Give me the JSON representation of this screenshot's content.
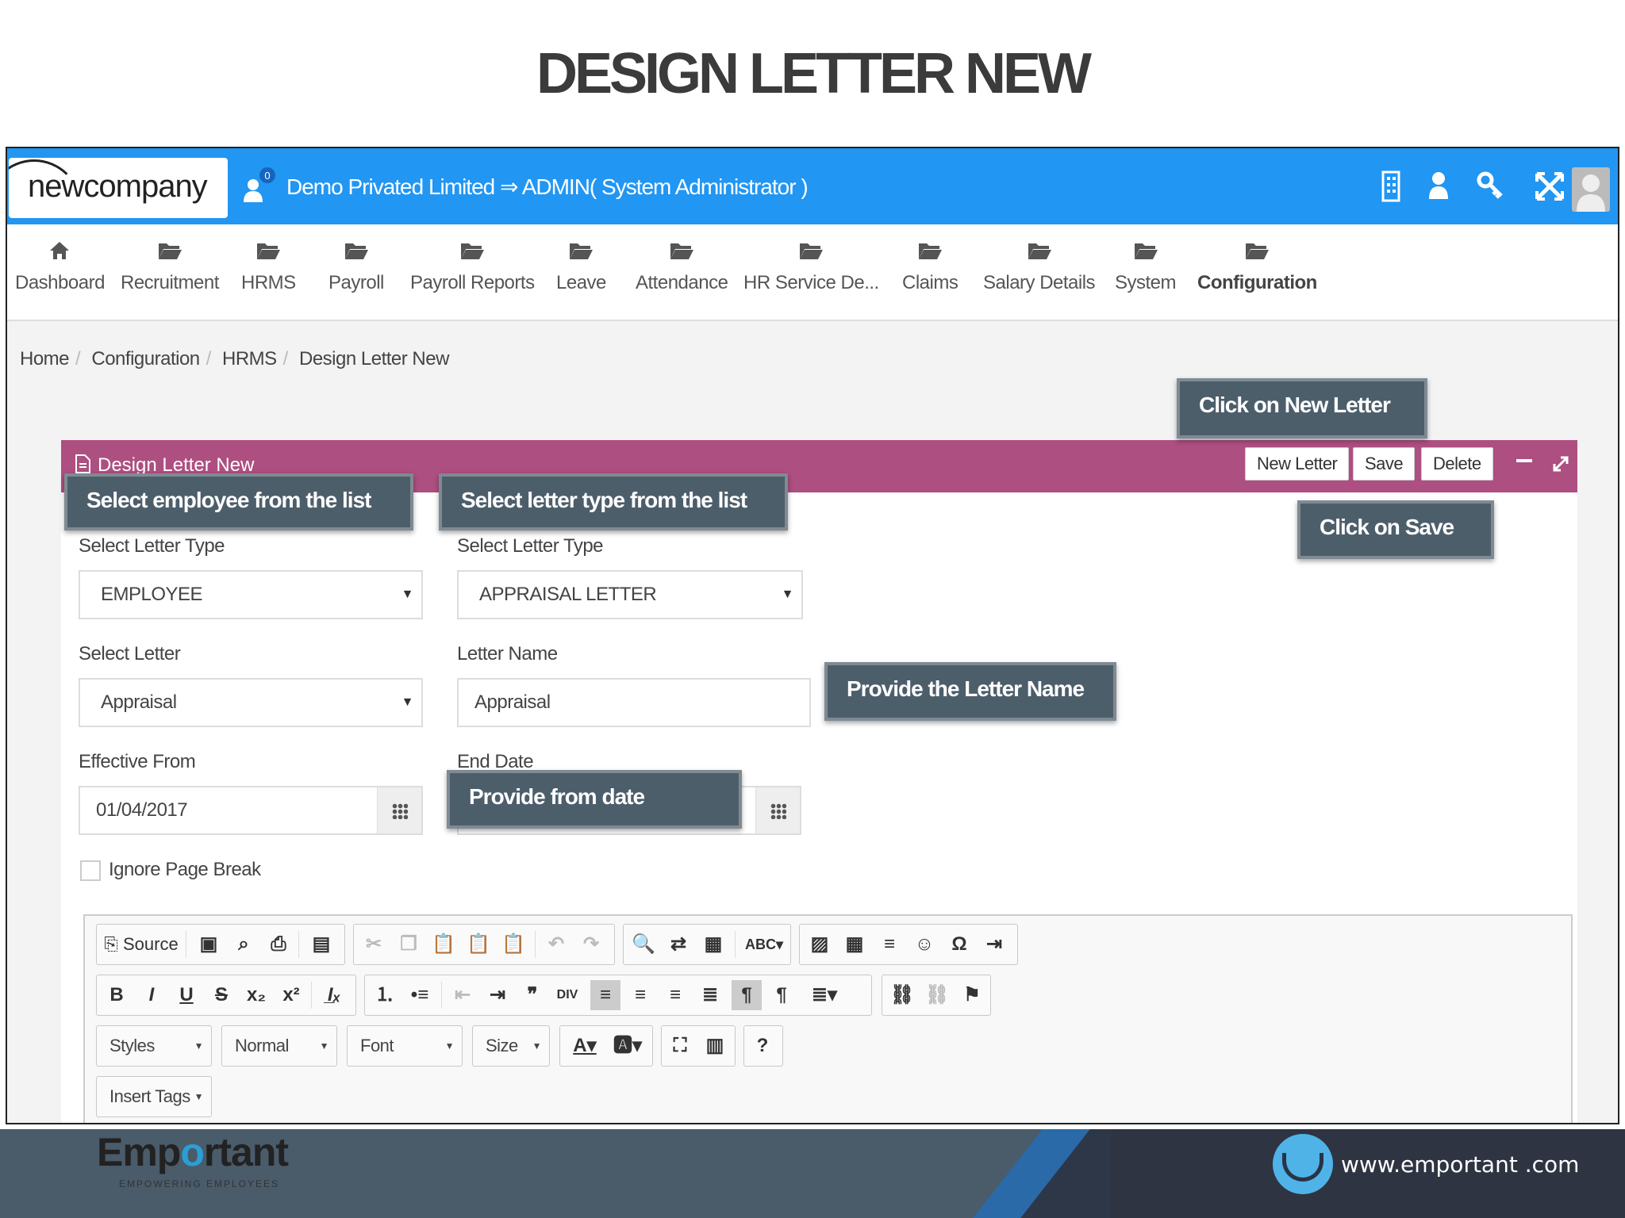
{
  "slide": {
    "title": "DESIGN LETTER NEW"
  },
  "app": {
    "logo_text": "newcompany",
    "notification_count": "0",
    "company_title": "Demo Privated Limited ⇒ ADMIN( System Administrator )",
    "top_icons": [
      "building-icon",
      "user-icon",
      "key-icon",
      "fullscreen-icon",
      "avatar"
    ]
  },
  "menu": [
    {
      "label": "Dashboard",
      "icon": "home-icon"
    },
    {
      "label": "Recruitment",
      "icon": "folder-icon"
    },
    {
      "label": "HRMS",
      "icon": "folder-icon"
    },
    {
      "label": "Payroll",
      "icon": "folder-icon"
    },
    {
      "label": "Payroll Reports",
      "icon": "folder-icon"
    },
    {
      "label": "Leave",
      "icon": "folder-icon"
    },
    {
      "label": "Attendance",
      "icon": "folder-icon"
    },
    {
      "label": "HR Service De...",
      "icon": "folder-icon"
    },
    {
      "label": "Claims",
      "icon": "folder-icon"
    },
    {
      "label": "Salary Details",
      "icon": "folder-icon"
    },
    {
      "label": "System",
      "icon": "folder-icon"
    },
    {
      "label": "Configuration",
      "icon": "folder-icon"
    }
  ],
  "breadcrumb": [
    "Home",
    "Configuration",
    "HRMS",
    "Design Letter New"
  ],
  "panel": {
    "title": "Design Letter New",
    "buttons": {
      "new_letter": "New Letter",
      "save": "Save",
      "delete": "Delete"
    },
    "header_color": "#ad4f81"
  },
  "form": {
    "select_letter_type_label_1": "Select Letter Type",
    "employee_value": "EMPLOYEE",
    "select_letter_type_label_2": "Select Letter Type",
    "letter_type_value": "APPRAISAL LETTER",
    "select_letter_label": "Select Letter",
    "select_letter_value": "Appraisal",
    "letter_name_label": "Letter Name",
    "letter_name_value": "Appraisal",
    "effective_from_label": "Effective From",
    "effective_from_value": "01/04/2017",
    "end_date_label": "End Date",
    "ignore_page_break_label": "Ignore Page Break",
    "ignore_page_break_checked": false
  },
  "editor": {
    "source_label": "Source",
    "styles_label": "Styles",
    "format_label": "Normal",
    "font_label": "Font",
    "size_label": "Size",
    "insert_tags_label": "Insert Tags"
  },
  "callouts": {
    "new_letter": "Click on New Letter",
    "save": "Click on Save",
    "employee": "Select employee from the list",
    "letter_type": "Select letter type from the list",
    "letter_name": "Provide the Letter Name",
    "from_date": "Provide from date"
  },
  "footer": {
    "brand_pre": "Emp",
    "brand_o": "o",
    "brand_post": "rtant",
    "tagline": "EMPOWERING EMPLOYEES",
    "website": "www.emportant .com"
  },
  "colors": {
    "topbar": "#2196f3",
    "callout": "#4d5e6b",
    "footer": "#4a5b6a"
  }
}
